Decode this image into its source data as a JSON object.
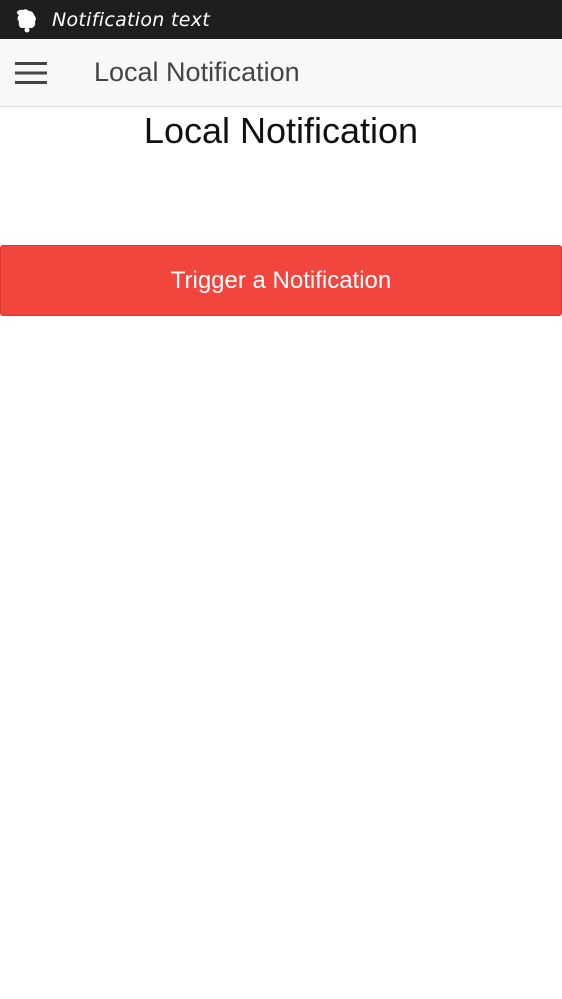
{
  "status_bar": {
    "notification_text": "Notification text",
    "icon": "bell-icon"
  },
  "app_bar": {
    "menu_icon": "hamburger-menu-icon",
    "title": "Local Notification"
  },
  "content": {
    "heading": "Local Notification",
    "trigger_button_label": "Trigger a Notification"
  },
  "colors": {
    "status_bar_bg": "#1e1e1e",
    "app_bar_bg": "#f8f8f8",
    "button_bg": "#f1453d",
    "button_text": "#ffffff"
  }
}
